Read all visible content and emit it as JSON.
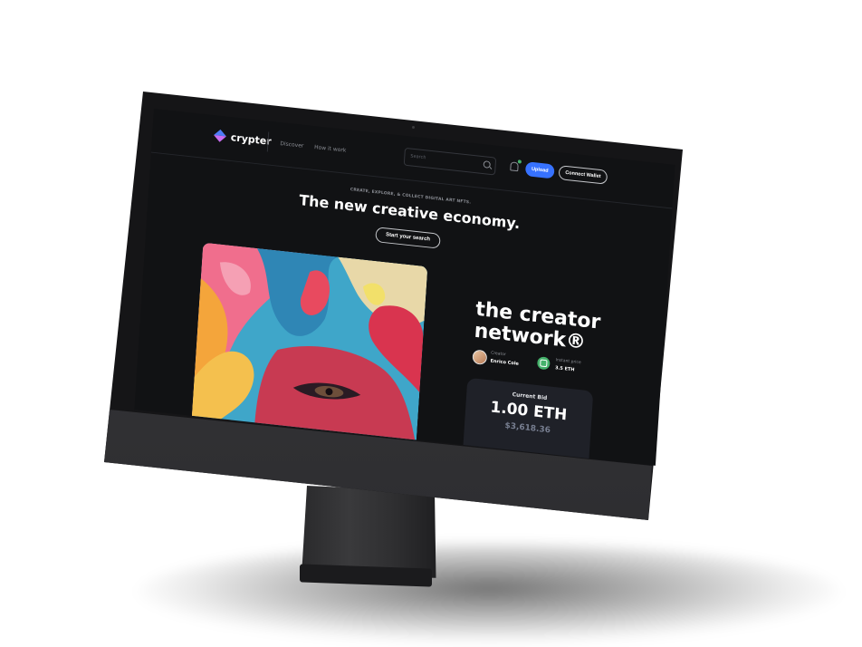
{
  "brand": {
    "name": "crypter"
  },
  "nav": {
    "links": [
      "Discover",
      "How it work"
    ],
    "search_placeholder": "Search",
    "upload_label": "Upload",
    "wallet_label": "Connect Wallet"
  },
  "hero": {
    "eyebrow": "CREATE, EXPLORE, & COLLECT DIGITAL ART NFTS.",
    "title": "The new creative economy.",
    "cta_label": "Start your search"
  },
  "feature": {
    "title_line1": "the creator",
    "title_line2": "network®",
    "creator_label": "Creator",
    "creator_name": "Enrico Cole",
    "price_label": "Instant price",
    "price_value": "3.5 ETH",
    "bid_label": "Current Bid",
    "bid_eth": "1.00 ETH",
    "bid_usd": "$3,618.36"
  },
  "colors": {
    "background": "#111214",
    "primary": "#3772ff",
    "success": "#45b26b",
    "card": "#1f2128"
  }
}
